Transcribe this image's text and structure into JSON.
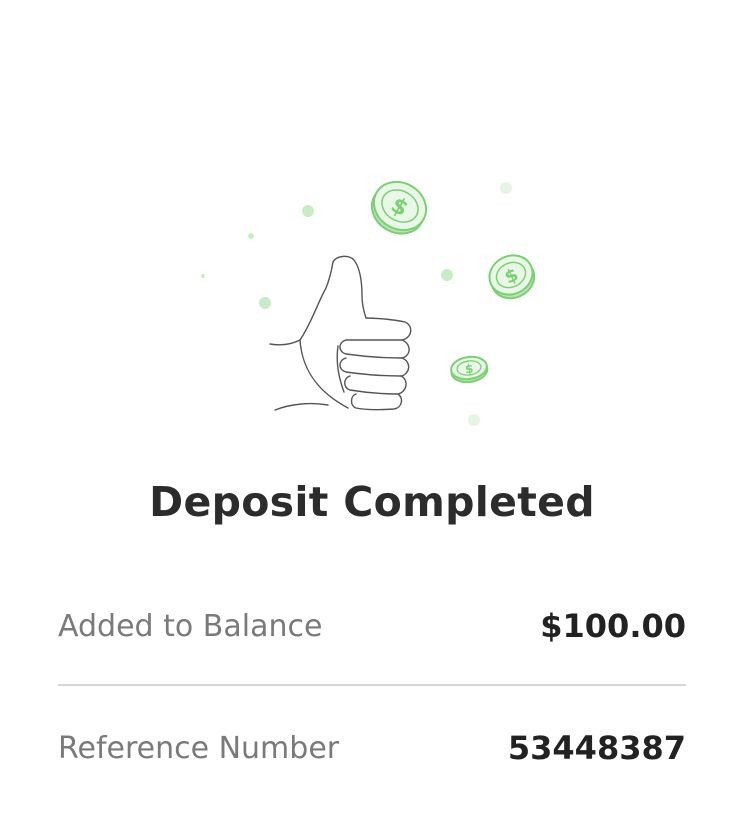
{
  "deposit": {
    "title": "Deposit Completed",
    "rows": [
      {
        "label": "Added to Balance",
        "value": "$100.00"
      },
      {
        "label": "Reference Number",
        "value": "53448387"
      }
    ]
  },
  "illustration": {
    "icon": "thumbs-up-with-coins",
    "accent_color": "#7ccf74",
    "dot_color": "#c9ebc5"
  }
}
